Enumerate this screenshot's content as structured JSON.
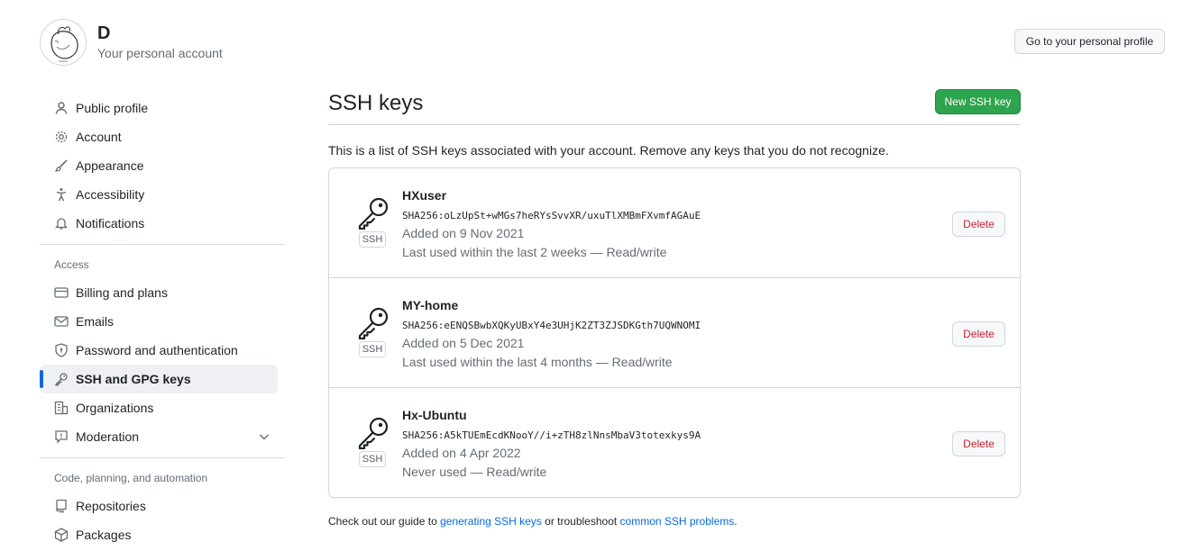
{
  "account": {
    "name": "D",
    "subtitle": "Your personal account",
    "profile_button": "Go to your personal profile"
  },
  "nav": {
    "items_top": [
      {
        "label": "Public profile",
        "icon": "person-icon"
      },
      {
        "label": "Account",
        "icon": "gear-icon"
      },
      {
        "label": "Appearance",
        "icon": "paintbrush-icon"
      },
      {
        "label": "Accessibility",
        "icon": "accessibility-icon"
      },
      {
        "label": "Notifications",
        "icon": "bell-icon"
      }
    ],
    "access_heading": "Access",
    "items_access": [
      {
        "label": "Billing and plans",
        "icon": "credit-card-icon"
      },
      {
        "label": "Emails",
        "icon": "mail-icon"
      },
      {
        "label": "Password and authentication",
        "icon": "shield-icon"
      },
      {
        "label": "SSH and GPG keys",
        "icon": "key-icon",
        "active": true
      },
      {
        "label": "Organizations",
        "icon": "organization-icon"
      },
      {
        "label": "Moderation",
        "icon": "report-icon"
      }
    ],
    "code_heading": "Code, planning, and automation",
    "items_code": [
      {
        "label": "Repositories",
        "icon": "repo-icon"
      },
      {
        "label": "Packages",
        "icon": "package-icon"
      }
    ]
  },
  "main": {
    "title": "SSH keys",
    "new_button": "New SSH key",
    "intro": "This is a list of SSH keys associated with your account. Remove any keys that you do not recognize.",
    "badge": "SSH",
    "delete_label": "Delete",
    "keys": [
      {
        "title": "HXuser",
        "fingerprint": "SHA256:oLzUpSt+wMGs7heRYsSvvXR/uxuTlXMBmFXvmfAGAuE",
        "added": "Added on 9 Nov 2021",
        "usage": "Last used within the last 2 weeks — Read/write"
      },
      {
        "title": "MY-home",
        "fingerprint": "SHA256:eENQSBwbXQKyUBxY4e3UHjK2ZT3ZJSDKGth7UQWNOMI",
        "added": "Added on 5 Dec 2021",
        "usage": "Last used within the last 4 months — Read/write"
      },
      {
        "title": "Hx-Ubuntu",
        "fingerprint": "SHA256:A5kTUEmEcdKNooY//i+zTH8zlNnsMbaV3totexkys9A",
        "added": "Added on 4 Apr 2022",
        "usage": "Never used — Read/write"
      }
    ],
    "footer": {
      "prefix": "Check out our guide to ",
      "link1": "generating SSH keys",
      "middle": " or troubleshoot ",
      "link2": "common SSH problems",
      "suffix": "."
    }
  },
  "colors": {
    "accent": "#0969da",
    "primary_button": "#2da44e",
    "danger": "#cf222e"
  }
}
